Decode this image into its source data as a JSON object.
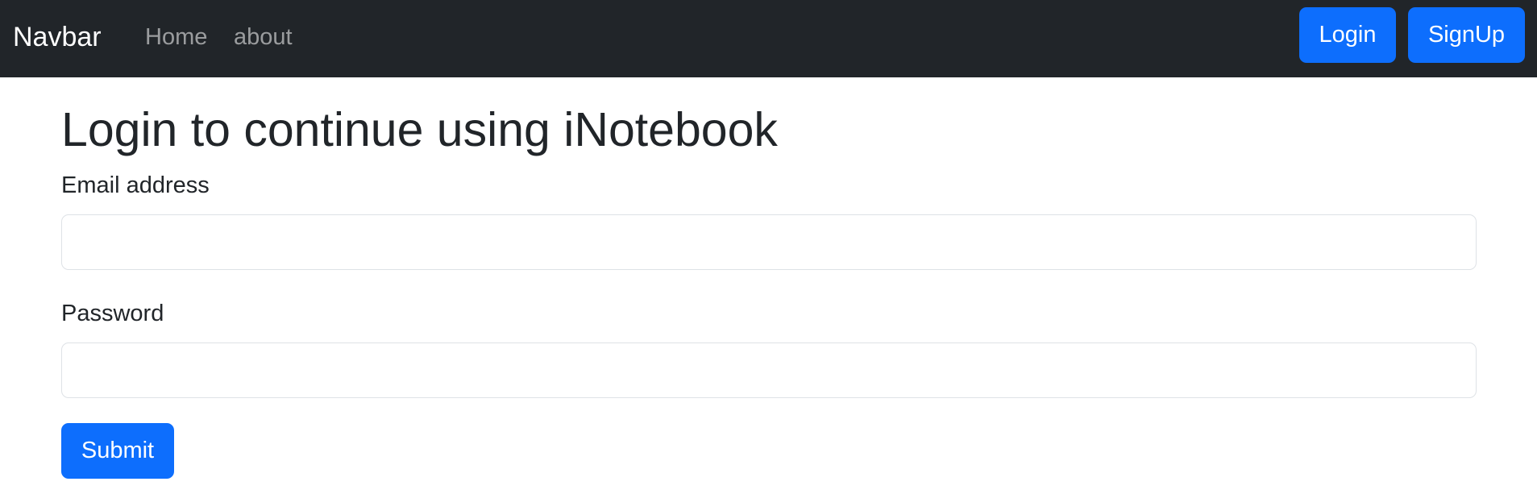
{
  "navbar": {
    "brand": "Navbar",
    "links": [
      {
        "label": "Home"
      },
      {
        "label": "about"
      }
    ],
    "login_label": "Login",
    "signup_label": "SignUp",
    "background_color": "#212529"
  },
  "main": {
    "title": "Login to continue using iNotebook",
    "email": {
      "label": "Email address",
      "value": "",
      "placeholder": ""
    },
    "password": {
      "label": "Password",
      "value": "",
      "placeholder": ""
    },
    "submit_label": "Submit"
  },
  "colors": {
    "primary": "#0d6efd",
    "text": "#212529"
  }
}
